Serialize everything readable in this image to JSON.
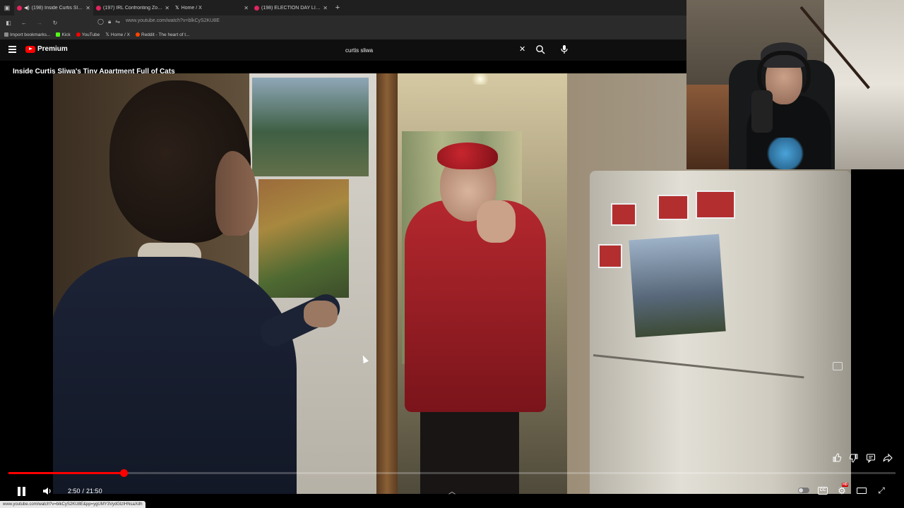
{
  "browser": {
    "tabs": [
      {
        "label": "(198) Inside Curtis Sliwa's T",
        "favicon": "youtube-icon",
        "active": true,
        "audio": true
      },
      {
        "label": "(197) IRL Confronting Zohran M",
        "favicon": "youtube-icon",
        "active": false
      },
      {
        "label": "Home / X",
        "favicon": "x-icon",
        "active": false
      },
      {
        "label": "(198) ELECTION DAY LIVE: Wat",
        "favicon": "youtube-icon",
        "active": false
      }
    ],
    "url": "www.youtube.com/watch?v=blkCyS2KU8E",
    "bookmarks": [
      {
        "label": "Import bookmarks...",
        "color": "#8c8c8c"
      },
      {
        "label": "Kick",
        "color": "#53fc18"
      },
      {
        "label": "YouTube",
        "color": "#ff0000"
      },
      {
        "label": "Home / X",
        "color": "#ffffff"
      },
      {
        "label": "Reddit - The heart of t...",
        "color": "#ff4500"
      }
    ],
    "status_url": "www.youtube.com/watch?v=blkCyS2KU8E&pp=ygUMY3VydGlzIHNsaXdh"
  },
  "youtube": {
    "logo_text": "Premium",
    "search_value": "curtis sliwa",
    "video_title": "Inside Curtis Sliwa's Tiny Apartment Full of Cats"
  },
  "player": {
    "current_time": "2:50",
    "separator": "/",
    "duration": "21:50",
    "progress_fraction": 0.1298,
    "hd_badge": "HD",
    "accent_color": "#ff0000"
  }
}
